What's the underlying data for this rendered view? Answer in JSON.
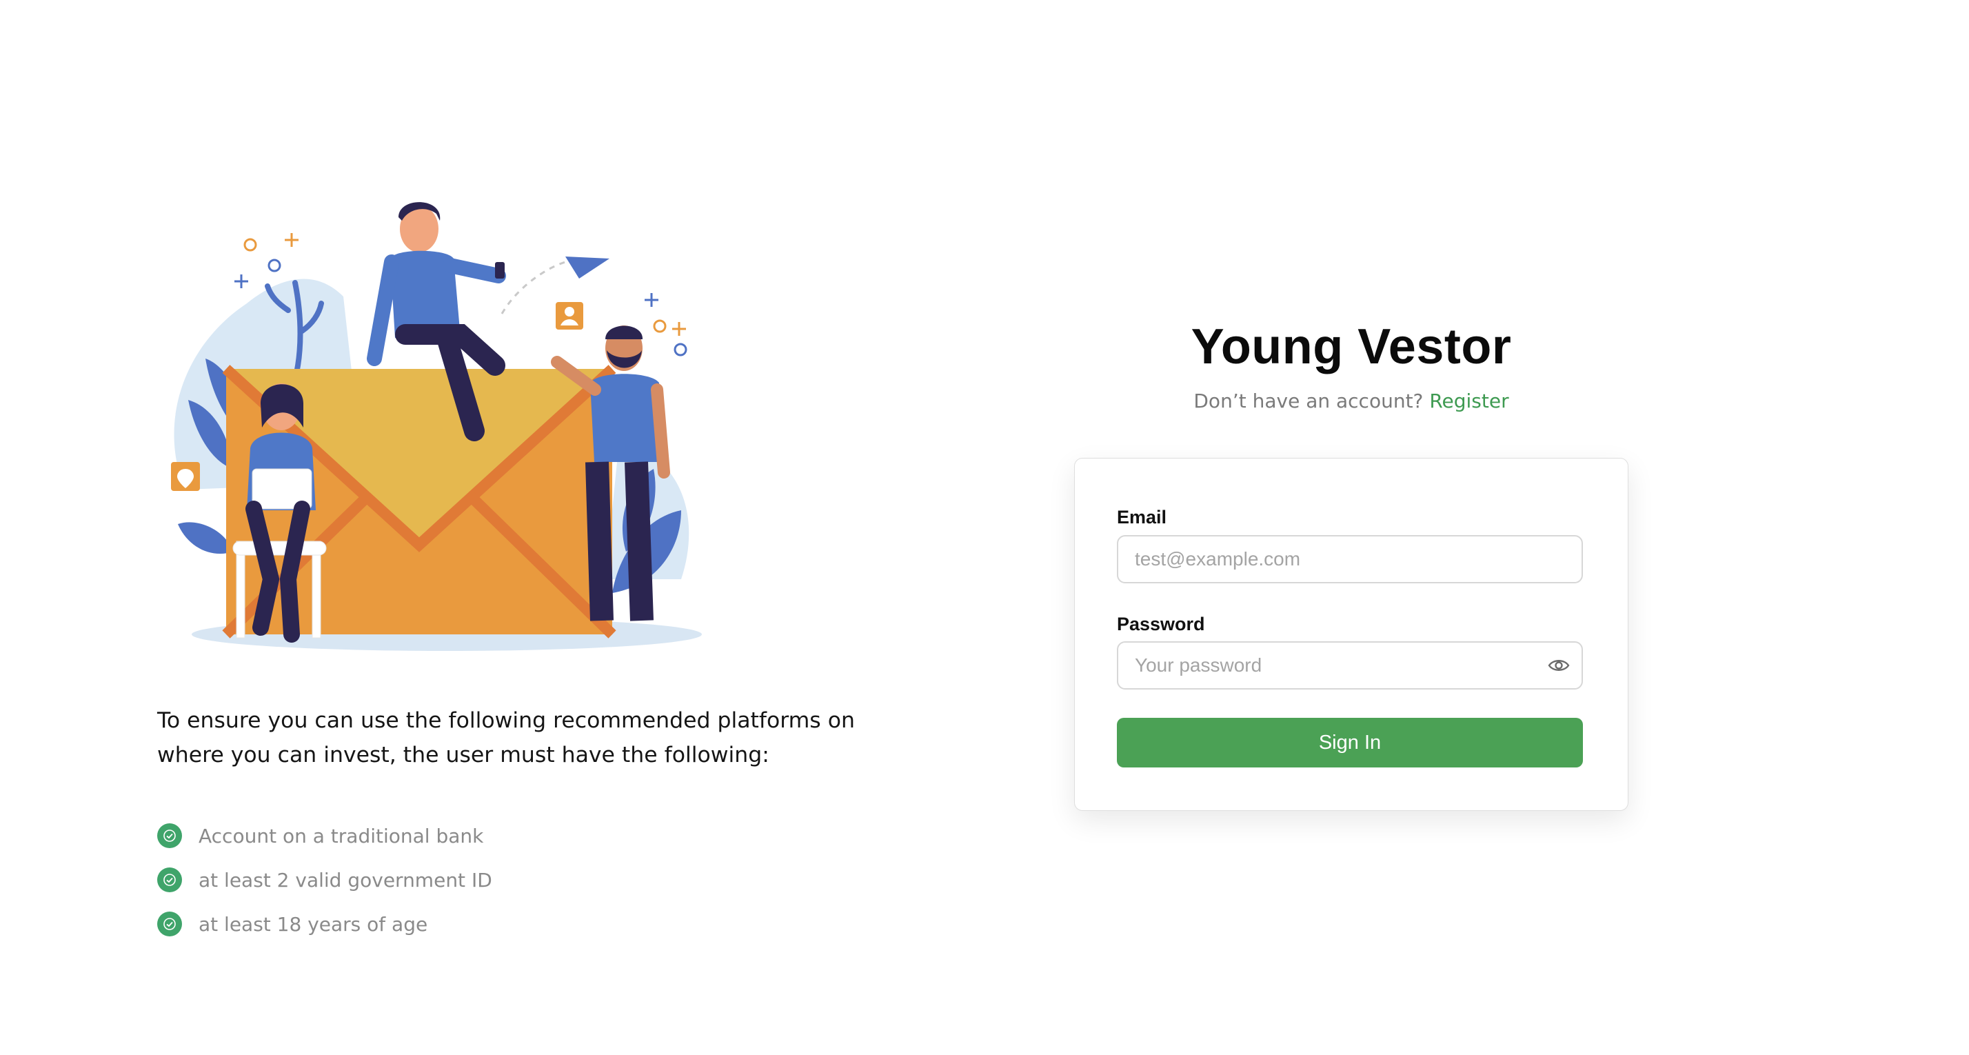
{
  "left": {
    "intro_text": "To ensure you can use the following recommended platforms on where you can invest, the user must have the following:",
    "requirements": [
      "Account on a traditional bank",
      "at least 2 valid government ID",
      "at least 18 years of age"
    ],
    "illustration_icon": "people-with-envelope-illustration"
  },
  "auth": {
    "brand": "Young Vestor",
    "no_account_text": "Don’t have an account?",
    "register_label": "Register",
    "email_label": "Email",
    "email_placeholder": "test@example.com",
    "email_value": "",
    "password_label": "Password",
    "password_placeholder": "Your password",
    "password_value": "",
    "show_password_icon": "eye-icon",
    "sign_in_label": "Sign In"
  },
  "colors": {
    "accent_green": "#4ba155",
    "check_green": "#3fa46a",
    "envelope_orange": "#e99a3e",
    "envelope_flap": "#e5b84f",
    "people_blue": "#4f78c8"
  }
}
